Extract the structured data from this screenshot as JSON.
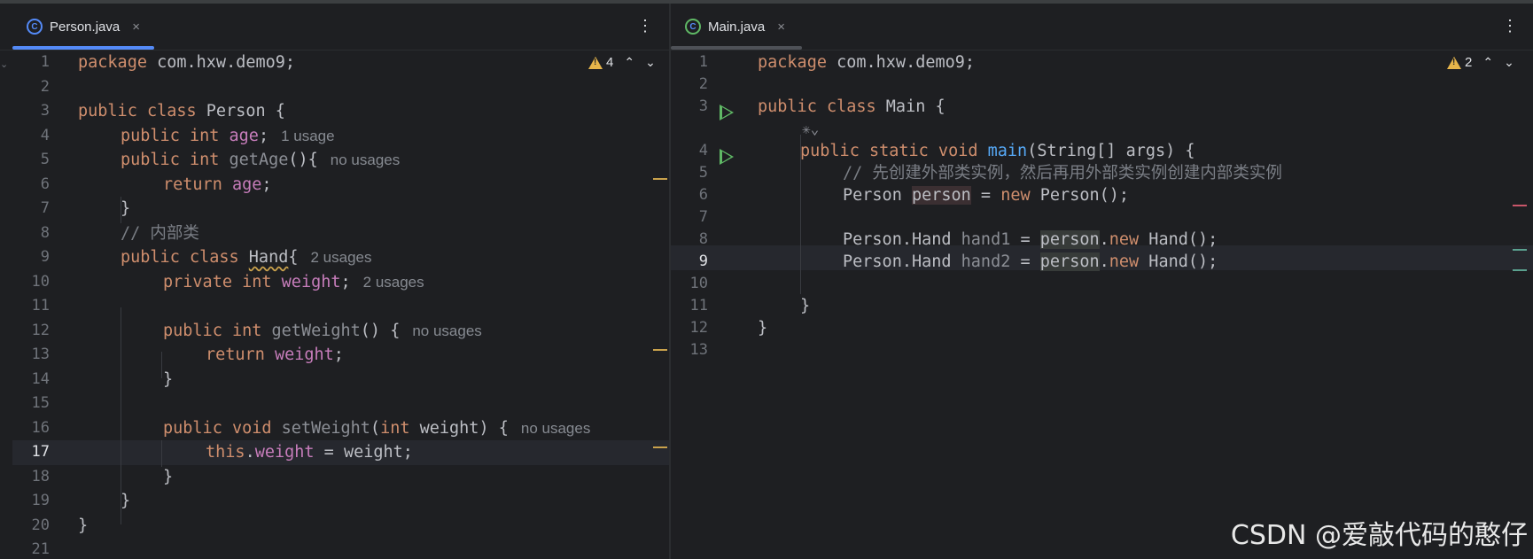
{
  "left_pane": {
    "tab": {
      "icon_letter": "C",
      "label": "Person.java",
      "close": "×"
    },
    "more": "⋮",
    "warnings": {
      "count": "4",
      "up": "⌃",
      "down": "⌄"
    },
    "lines": [
      {
        "n": "1"
      },
      {
        "n": "2"
      },
      {
        "n": "3"
      },
      {
        "n": "4"
      },
      {
        "n": "5"
      },
      {
        "n": "6"
      },
      {
        "n": "7"
      },
      {
        "n": "8"
      },
      {
        "n": "9"
      },
      {
        "n": "10"
      },
      {
        "n": "11"
      },
      {
        "n": "12"
      },
      {
        "n": "13"
      },
      {
        "n": "14"
      },
      {
        "n": "15"
      },
      {
        "n": "16"
      },
      {
        "n": "17"
      },
      {
        "n": "18"
      },
      {
        "n": "19"
      },
      {
        "n": "20"
      },
      {
        "n": "21"
      }
    ],
    "code": {
      "l1_kw": "package",
      "l1_rest": " com.hxw.demo9;",
      "l3_kw": "public class",
      "l3_rest": " Person {",
      "l4_kw": "public int",
      "l4_fld": "age",
      "l4_rest": ";",
      "l4_hint": "1 usage",
      "l5_kw": "public int",
      "l5_fn": "getAge",
      "l5_rest": "(){",
      "l5_hint": "no usages",
      "l6_kw": "return",
      "l6_fld": "age",
      "l6_rest": ";",
      "l7": "}",
      "l8_cmt": "// 内部类",
      "l9_kw": "public class",
      "l9_cls": "Hand",
      "l9_rest": "{",
      "l9_hint": "2 usages",
      "l10_kw": "private int",
      "l10_fld": "weight",
      "l10_rest": ";",
      "l10_hint": "2 usages",
      "l12_kw": "public int",
      "l12_fn": "getWeight",
      "l12_rest": "() {",
      "l12_hint": "no usages",
      "l13_kw": "return",
      "l13_fld": "weight",
      "l13_rest": ";",
      "l14": "}",
      "l16_kw": "public void",
      "l16_fn": "setWeight",
      "l16_p1": "(",
      "l16_kw2": "int",
      "l16_rest": " weight) {",
      "l16_hint": "no usages",
      "l17_kw": "this",
      "l17_dot": ".",
      "l17_fld": "weight",
      "l17_rest": " = weight;",
      "l18": "}",
      "l19": "}",
      "l20": "}"
    }
  },
  "right_pane": {
    "tab": {
      "icon_letter": "C",
      "label": "Main.java",
      "close": "×"
    },
    "more": "⋮",
    "warnings": {
      "count": "2",
      "up": "⌃",
      "down": "⌄"
    },
    "lines": [
      {
        "n": "1"
      },
      {
        "n": "2"
      },
      {
        "n": "3"
      },
      {
        "n": "4"
      },
      {
        "n": "5"
      },
      {
        "n": "6"
      },
      {
        "n": "7"
      },
      {
        "n": "8"
      },
      {
        "n": "9"
      },
      {
        "n": "10"
      },
      {
        "n": "11"
      },
      {
        "n": "12"
      },
      {
        "n": "13"
      }
    ],
    "code": {
      "l1_kw": "package",
      "l1_rest": " com.hxw.demo9;",
      "l3_kw": "public class",
      "l3_rest": " Main {",
      "ai_hint": "✳⌄",
      "l4_kw": "public static void",
      "l4_fn": "main",
      "l4_rest": "(String[] args) {",
      "l5_cmt": "// 先创建外部类实例，然后再用外部类实例创建内部类实例",
      "l6_a": "Person ",
      "l6_var": "person",
      "l6_b": " = ",
      "l6_kw": "new",
      "l6_c": " Person();",
      "l8_a": "Person.Hand ",
      "l8_var": "hand1",
      "l8_b": " = ",
      "l8_ref": "person",
      "l8_dot": ".",
      "l8_kw": "new",
      "l8_c": " Hand();",
      "l9_a": "Person.Hand ",
      "l9_var": "hand2",
      "l9_b": " = ",
      "l9_ref": "person",
      "l9_dot": ".",
      "l9_kw": "new",
      "l9_c": " Hand();",
      "l11": "}",
      "l12": "}"
    }
  },
  "watermark": "CSDN @爱敲代码的憨仔",
  "colors": {
    "accent": "#548af7",
    "keyword": "#cf8e6d",
    "field": "#c77dbb",
    "function": "#56a8f5",
    "warning": "#e6b54a",
    "run": "#5fb865"
  }
}
